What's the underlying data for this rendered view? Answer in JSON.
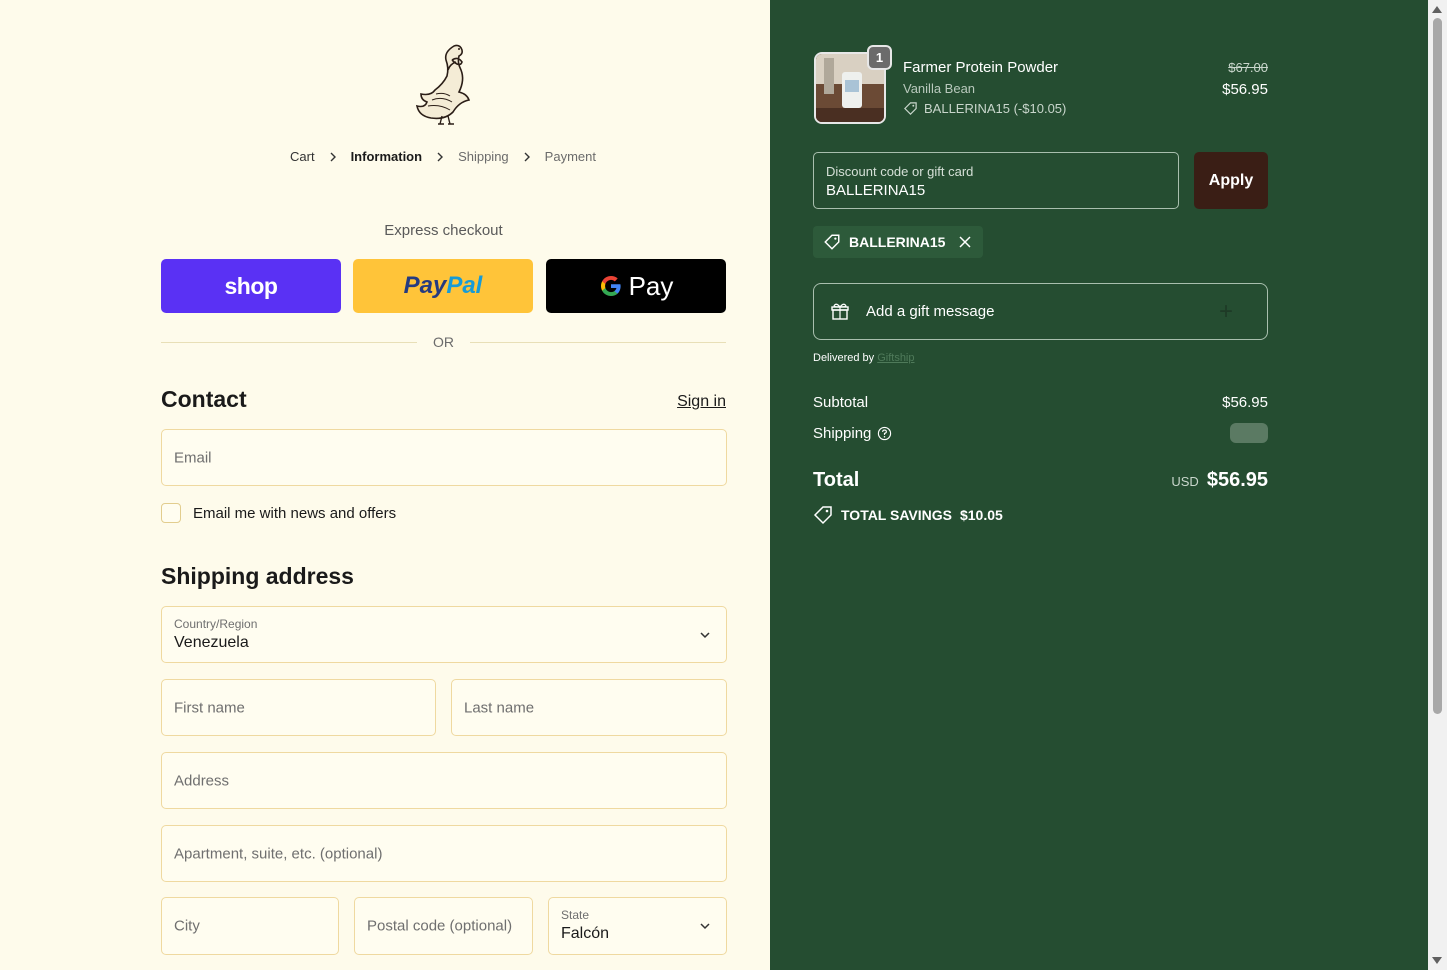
{
  "breadcrumb": {
    "items": [
      {
        "label": "Cart"
      },
      {
        "label": "Information"
      },
      {
        "label": "Shipping"
      },
      {
        "label": "Payment"
      }
    ]
  },
  "express": {
    "heading": "Express checkout",
    "shop_label": "shop",
    "paypal_label_1": "Pay",
    "paypal_label_2": "Pal",
    "gpay_g": "G",
    "gpay_label": "Pay",
    "or_label": "OR"
  },
  "contact": {
    "heading": "Contact",
    "signin_label": "Sign in",
    "email_placeholder": "Email",
    "newsletter_label": "Email me with news and offers"
  },
  "shipping": {
    "heading": "Shipping address",
    "country_label": "Country/Region",
    "country_value": "Venezuela",
    "first_name_placeholder": "First name",
    "last_name_placeholder": "Last name",
    "address_placeholder": "Address",
    "apartment_placeholder": "Apartment, suite, etc. (optional)",
    "city_placeholder": "City",
    "postal_placeholder": "Postal code (optional)",
    "state_label": "State",
    "state_value": "Falcón"
  },
  "summary": {
    "product": {
      "quantity": "1",
      "name": "Farmer Protein Powder",
      "variant": "Vanilla Bean",
      "discount": "BALLERINA15 (-$10.05)",
      "old_price": "$67.00",
      "price": "$56.95"
    },
    "discount_field": {
      "label": "Discount code or gift card",
      "value": "BALLERINA15"
    },
    "apply_label": "Apply",
    "applied_code": "BALLERINA15",
    "gift_label": "Add a gift message",
    "delivered_by": "Delivered by",
    "delivered_link": "Giftship",
    "subtotal_label": "Subtotal",
    "subtotal_value": "$56.95",
    "shipping_label": "Shipping",
    "total_label": "Total",
    "currency": "USD",
    "total_value": "$56.95",
    "savings_label": "TOTAL SAVINGS",
    "savings_value": "$10.05"
  },
  "colors": {
    "background": "#fefbeb",
    "summary_bg": "#254d31",
    "shop_pay": "#5a31f4",
    "paypal": "#ffc439",
    "apply_btn": "#3a1e15"
  }
}
